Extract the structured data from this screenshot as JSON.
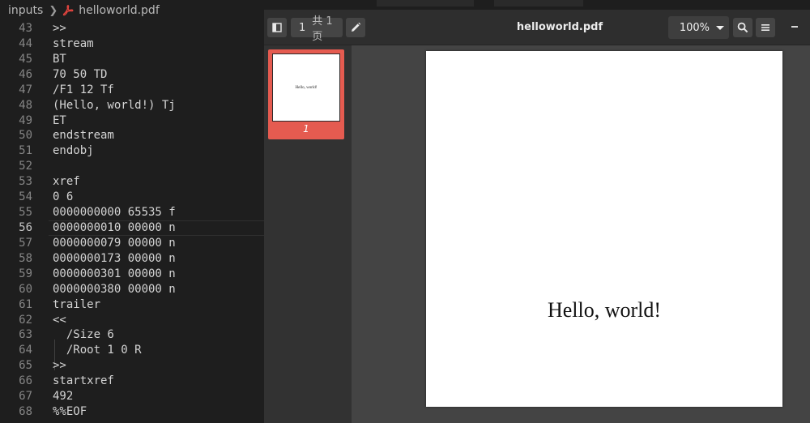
{
  "breadcrumb": {
    "folder": "inputs",
    "file": "helloworld.pdf"
  },
  "code_lines": [
    {
      "n": "43",
      "t": ">>"
    },
    {
      "n": "44",
      "t": "stream"
    },
    {
      "n": "45",
      "t": "BT"
    },
    {
      "n": "46",
      "t": "70 50 TD"
    },
    {
      "n": "47",
      "t": "/F1 12 Tf"
    },
    {
      "n": "48",
      "t": "(Hello, world!) Tj"
    },
    {
      "n": "49",
      "t": "ET"
    },
    {
      "n": "50",
      "t": "endstream"
    },
    {
      "n": "51",
      "t": "endobj"
    },
    {
      "n": "52",
      "t": ""
    },
    {
      "n": "53",
      "t": "xref"
    },
    {
      "n": "54",
      "t": "0 6"
    },
    {
      "n": "55",
      "t": "0000000000 65535 f"
    },
    {
      "n": "56",
      "t": "0000000010 00000 n"
    },
    {
      "n": "57",
      "t": "0000000079 00000 n"
    },
    {
      "n": "58",
      "t": "0000000173 00000 n"
    },
    {
      "n": "59",
      "t": "0000000301 00000 n"
    },
    {
      "n": "60",
      "t": "0000000380 00000 n"
    },
    {
      "n": "61",
      "t": "trailer"
    },
    {
      "n": "62",
      "t": "<<"
    },
    {
      "n": "63",
      "t": "  /Size 6"
    },
    {
      "n": "64",
      "t": "  /Root 1 0 R"
    },
    {
      "n": "65",
      "t": ">>"
    },
    {
      "n": "66",
      "t": "startxref"
    },
    {
      "n": "67",
      "t": "492"
    },
    {
      "n": "68",
      "t": "%%EOF"
    }
  ],
  "current_line": "56",
  "viewer": {
    "page_number": "1",
    "page_total": "共 1 页",
    "title": "helloworld.pdf",
    "zoom": "100%",
    "thumbnail_label": "1",
    "thumbnail_text": "Hello, world!",
    "page_text": "Hello, world!"
  },
  "colors": {
    "editor_bg": "#1e1e1e",
    "viewer_toolbar": "#2e2e2e",
    "thumbnail_selected": "#e55b50",
    "pdf_icon": "#e0443e"
  },
  "icons": {
    "breadcrumb_sep": "chevron-right-icon",
    "file": "pdf-file-icon",
    "sidebar_toggle": "sidebar-toggle-icon",
    "annotate": "pencil-icon",
    "search": "search-icon",
    "menu": "hamburger-menu-icon",
    "minimize": "minimize-icon"
  }
}
